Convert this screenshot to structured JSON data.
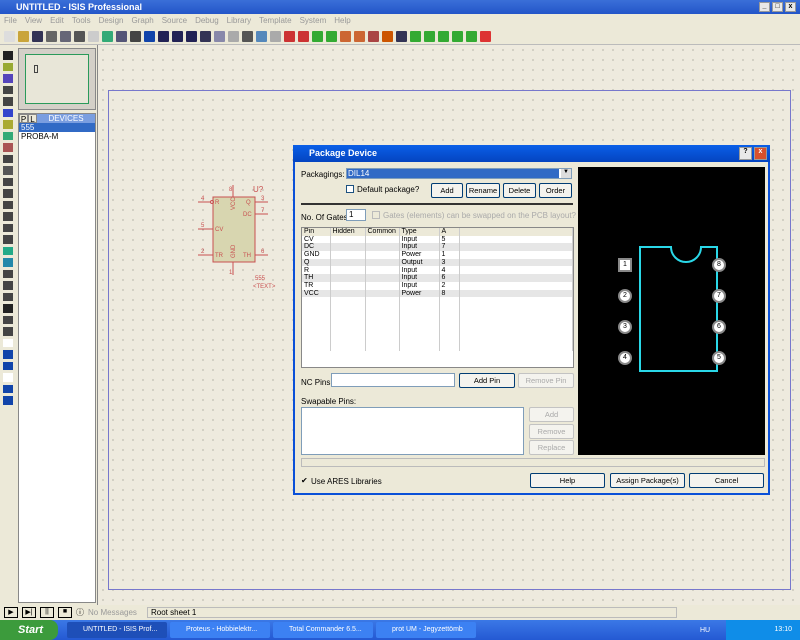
{
  "window": {
    "title": "UNTITLED - ISIS Professional"
  },
  "menu": [
    "File",
    "View",
    "Edit",
    "Tools",
    "Design",
    "Graph",
    "Source",
    "Debug",
    "Library",
    "Template",
    "System",
    "Help"
  ],
  "devices": {
    "tab_p": "P",
    "tab_l": "L",
    "header": "DEVICES",
    "items": [
      "555",
      "PROBA-M"
    ]
  },
  "schematic": {
    "ref": "U?",
    "value": "555",
    "text": "<TEXT>",
    "pins": {
      "R": "R",
      "CV": "CV",
      "TR": "TR",
      "Q": "Q",
      "DC": "DC",
      "TH": "TH",
      "VCC": "VCC",
      "GND": "GND",
      "n4": "4",
      "n5": "5",
      "n2": "2",
      "n3": "3",
      "n7": "7",
      "n6": "6",
      "n8": "8",
      "n1": "1"
    }
  },
  "dialog": {
    "title": "Package Device",
    "packagings_label": "Packagings:",
    "packaging_value": "DIL14",
    "default_package_label": "Default package?",
    "buttons": {
      "add": "Add",
      "rename": "Rename",
      "delete": "Delete",
      "order": "Order",
      "add_pin": "Add Pin",
      "remove_pin": "Remove Pin",
      "swap_add": "Add",
      "swap_remove": "Remove",
      "swap_replace": "Replace",
      "help": "Help",
      "assign": "Assign Package(s)",
      "cancel": "Cancel"
    },
    "gates_label": "No. Of Gates:",
    "gates_value": "1",
    "gates_swap_label": "Gates (elements) can be swapped on the PCB layout?",
    "columns": [
      "Pin",
      "Hidden",
      "Common",
      "Type",
      "A"
    ],
    "rows": [
      [
        "CV",
        "",
        "",
        "Input",
        "5"
      ],
      [
        "DC",
        "",
        "",
        "Input",
        "7"
      ],
      [
        "GND",
        "",
        "",
        "Power",
        "1"
      ],
      [
        "Q",
        "",
        "",
        "Output",
        "3"
      ],
      [
        "R",
        "",
        "",
        "Input",
        "4"
      ],
      [
        "TH",
        "",
        "",
        "Input",
        "6"
      ],
      [
        "TR",
        "",
        "",
        "Input",
        "2"
      ],
      [
        "VCC",
        "",
        "",
        "Power",
        "8"
      ]
    ],
    "nc_pins_label": "NC Pins:",
    "swapable_label": "Swapable Pins:",
    "use_ares_label": "Use ARES Libraries",
    "use_ares_checked": true,
    "preview_pads": [
      "1",
      "2",
      "3",
      "4",
      "5",
      "6",
      "7",
      "8"
    ]
  },
  "status": {
    "messages": "No Messages",
    "sheet": "Root sheet 1"
  },
  "taskbar": {
    "start": "Start",
    "tasks": [
      "UNTITLED - ISIS Prof...",
      "Proteus - Hobbielektr...",
      "Total Commander 6.5...",
      "prot UM - Jegyzettömb"
    ],
    "lang": "HU",
    "clock": "13:10"
  }
}
